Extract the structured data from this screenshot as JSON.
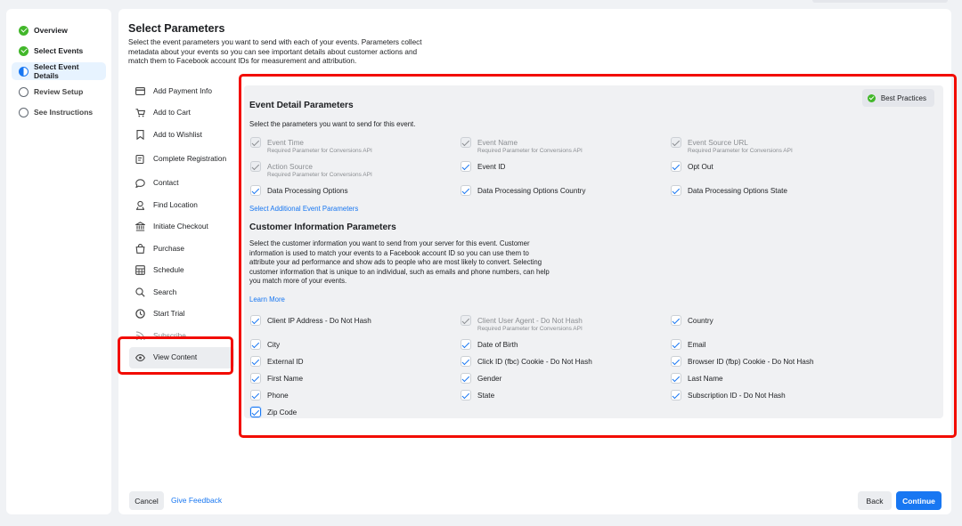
{
  "stepper": {
    "steps": [
      {
        "label": "Overview",
        "status": "done"
      },
      {
        "label": "Select Events",
        "status": "done"
      },
      {
        "label": "Select Event Details",
        "status": "active"
      },
      {
        "label": "Review Setup",
        "status": "pending"
      },
      {
        "label": "See Instructions",
        "status": "pending"
      }
    ]
  },
  "main": {
    "title": "Select Parameters",
    "description": "Select the event parameters you want to send with each of your events. Parameters collect metadata about your events so you can see important details about customer actions and match them to Facebook account IDs for measurement and attribution."
  },
  "events": [
    {
      "label": "Add Payment Info",
      "icon": "credit-card-icon"
    },
    {
      "label": "Add to Cart",
      "icon": "cart-icon"
    },
    {
      "label": "Add to Wishlist",
      "icon": "bookmark-icon"
    },
    {
      "label": "Complete Registration",
      "icon": "registration-icon"
    },
    {
      "label": "Contact",
      "icon": "chat-bubble-icon"
    },
    {
      "label": "Find Location",
      "icon": "location-pin-icon"
    },
    {
      "label": "Initiate Checkout",
      "icon": "bank-icon"
    },
    {
      "label": "Purchase",
      "icon": "shopping-bag-icon"
    },
    {
      "label": "Schedule",
      "icon": "calendar-grid-icon"
    },
    {
      "label": "Search",
      "icon": "search-icon"
    },
    {
      "label": "Start Trial",
      "icon": "clock-icon"
    },
    {
      "label": "Subscribe",
      "icon": "rss-icon"
    },
    {
      "label": "View Content",
      "icon": "eye-icon"
    }
  ],
  "event_details": {
    "title": "Event Detail Parameters",
    "subtitle": "Select the parameters you want to send for this event.",
    "best_practices": "Best Practices",
    "params": [
      {
        "name": "Event Time",
        "sub": "Required Parameter for Conversions API",
        "disabled": true
      },
      {
        "name": "Event Name",
        "sub": "Required Parameter for Conversions API",
        "disabled": true
      },
      {
        "name": "Event Source URL",
        "sub": "Required Parameter for Conversions API",
        "disabled": true
      },
      {
        "name": "Action Source",
        "sub": "Required Parameter for Conversions API",
        "disabled": true
      },
      {
        "name": "Event ID",
        "sub": "",
        "disabled": false
      },
      {
        "name": "Opt Out",
        "sub": "",
        "disabled": false
      },
      {
        "name": "Data Processing Options",
        "sub": "",
        "disabled": false
      },
      {
        "name": "Data Processing Options Country",
        "sub": "",
        "disabled": false
      },
      {
        "name": "Data Processing Options State",
        "sub": "",
        "disabled": false
      }
    ],
    "additional_link": "Select Additional Event Parameters"
  },
  "customer_info": {
    "title": "Customer Information Parameters",
    "description": "Select the customer information you want to send from your server for this event. Customer information is used to match your events to a Facebook account ID so you can use them to attribute your ad performance and show ads to people who are most likely to convert. Selecting customer information that is unique to an individual, such as emails and phone numbers, can help you match more of your events.",
    "learn_more": "Learn More",
    "params": [
      {
        "name": "Client IP Address - Do Not Hash",
        "sub": "",
        "disabled": false
      },
      {
        "name": "Client User Agent - Do Not Hash",
        "sub": "Required Parameter for Conversions API",
        "disabled": true
      },
      {
        "name": "Country",
        "sub": "",
        "disabled": false
      },
      {
        "name": "City",
        "sub": "",
        "disabled": false
      },
      {
        "name": "Date of Birth",
        "sub": "",
        "disabled": false
      },
      {
        "name": "Email",
        "sub": "",
        "disabled": false
      },
      {
        "name": "External ID",
        "sub": "",
        "disabled": false
      },
      {
        "name": "Click ID (fbc) Cookie - Do Not Hash",
        "sub": "",
        "disabled": false
      },
      {
        "name": "Browser ID (fbp) Cookie - Do Not Hash",
        "sub": "",
        "disabled": false
      },
      {
        "name": "First Name",
        "sub": "",
        "disabled": false
      },
      {
        "name": "Gender",
        "sub": "",
        "disabled": false
      },
      {
        "name": "Last Name",
        "sub": "",
        "disabled": false
      },
      {
        "name": "Phone",
        "sub": "",
        "disabled": false
      },
      {
        "name": "State",
        "sub": "",
        "disabled": false
      },
      {
        "name": "Subscription ID - Do Not Hash",
        "sub": "",
        "disabled": false
      },
      {
        "name": "Zip Code",
        "sub": "",
        "disabled": false
      }
    ]
  },
  "footer": {
    "cancel": "Cancel",
    "feedback": "Give Feedback",
    "back": "Back",
    "continue": "Continue"
  },
  "colors": {
    "accent": "#1877f2",
    "success": "#42b72a",
    "annotation": "#f20c00"
  }
}
